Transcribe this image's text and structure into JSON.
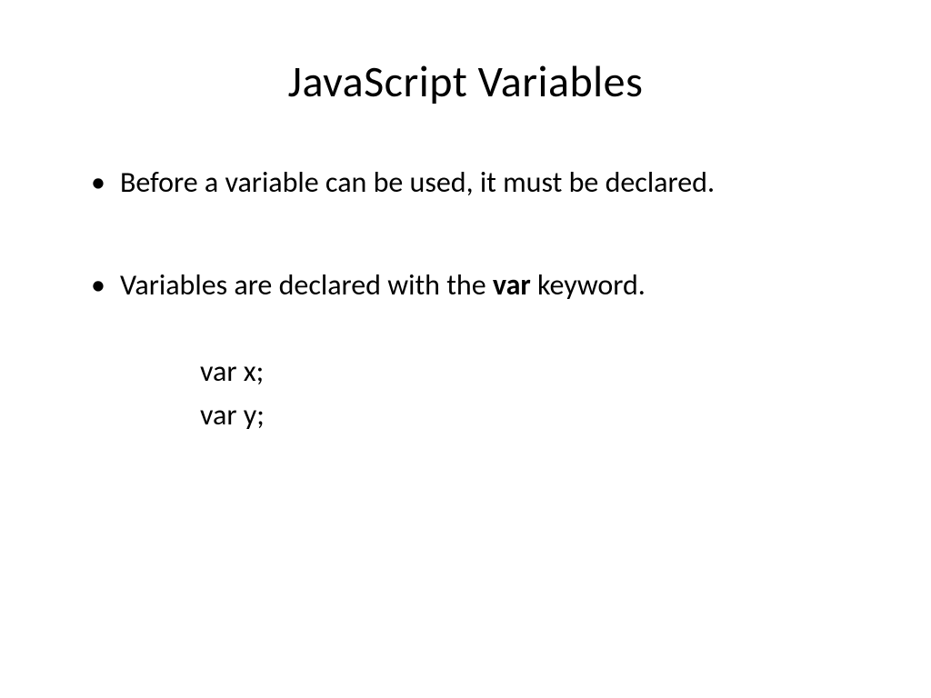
{
  "slide": {
    "title": "JavaScript Variables",
    "bullets": [
      {
        "text": "Before a variable can be used, it must be declared."
      },
      {
        "prefix": "Variables are declared with the ",
        "bold": "var",
        "suffix": " keyword."
      }
    ],
    "code": [
      "var x;",
      "var y;"
    ]
  }
}
